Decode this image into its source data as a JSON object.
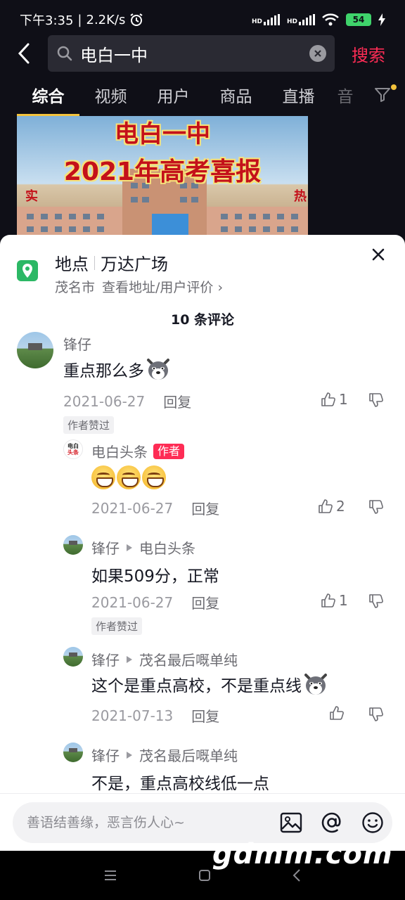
{
  "status": {
    "time": "下午3:35",
    "speed": "2.2K/s",
    "battery": "54",
    "hd1": "HD",
    "hd2": "HD"
  },
  "search": {
    "query": "电白一中",
    "submit_label": "搜索"
  },
  "tabs": [
    {
      "label": "综合"
    },
    {
      "label": "视频"
    },
    {
      "label": "用户"
    },
    {
      "label": "商品"
    },
    {
      "label": "直播"
    },
    {
      "label": "音"
    }
  ],
  "cover": {
    "title1": "电白一中",
    "title2": "2021年高考喜报",
    "side_left": "实",
    "side_right": "热"
  },
  "location": {
    "label": "地点",
    "name": "万达广场",
    "city": "茂名市",
    "link": "查看地址/用户评价",
    "chevron": "›"
  },
  "comment_count": "10 条评论",
  "comments": [
    {
      "user": "锋仔",
      "text": "重点那么多",
      "date": "2021-06-27",
      "reply": "回复",
      "likes": "1",
      "badge": "作者赞过"
    },
    {
      "user": "电白头条",
      "author_tag": "作者",
      "avatar_text_top": "电白",
      "avatar_text_bottom": "头条",
      "date": "2021-06-27",
      "reply": "回复",
      "likes": "2"
    },
    {
      "user": "锋仔",
      "reply_to": "电白头条",
      "text": "如果509分，正常",
      "date": "2021-06-27",
      "reply": "回复",
      "likes": "1",
      "badge": "作者赞过"
    },
    {
      "user": "锋仔",
      "reply_to": "茂名最后嘅单纯",
      "text": "这个是重点高校，不是重点线",
      "date": "2021-07-13",
      "reply": "回复"
    },
    {
      "user": "锋仔",
      "reply_to": "茂名最后嘅单纯",
      "text": "不是，重点高校线低一点"
    }
  ],
  "input": {
    "placeholder": "善语结善缘，恶言伤人心~"
  },
  "watermark": "gdmm.com"
}
